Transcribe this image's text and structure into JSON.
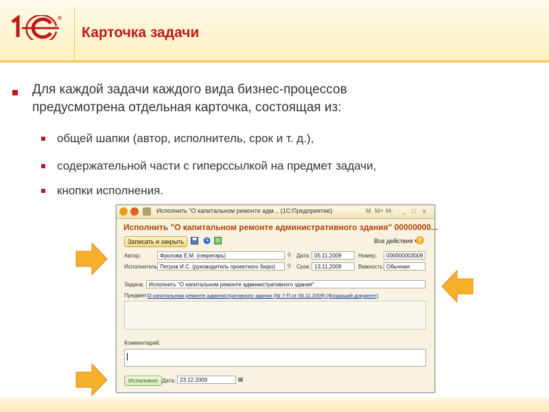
{
  "slide": {
    "title": "Карточка задачи",
    "bullet_line1": "Для каждой задачи каждого вида бизнес-процессов",
    "bullet_line2": "предусмотрена отдельная карточка, состоящая из:",
    "sub_bullets": [
      "общей шапки (автор, исполнитель, срок и т. д.),",
      "содержательной части с гиперссылкой на предмет задачи,",
      "кнопки исполнения."
    ],
    "accent_color": "#c01818",
    "arrow_color": "#f7b02a"
  },
  "window": {
    "title": "Исполнить \"О капитальном ремонте адм... (1С:Предприятие)",
    "controls": [
      "M",
      "M+",
      "M-",
      "_",
      "□",
      "x"
    ],
    "form_title": "Исполнить \"О капитальном ремонте административного здания\" 00000000...",
    "toolbar": {
      "save_close": "Записать и закрыть",
      "all_actions": "Все действия ▾",
      "help": "?"
    },
    "fields": {
      "author_label": "Автор:",
      "author_value": "Фролова Е.М. (секретарь)",
      "date_label": "Дата:",
      "date_value": "05.11.2009",
      "number_label": "Номер:",
      "number_value": "000000003009",
      "executor_label": "Исполнитель:",
      "executor_value": "Петров И.С. (руководитель проектного бюро)",
      "deadline_label": "Срок:",
      "deadline_value": "13.11.2009",
      "importance_label": "Важность:",
      "importance_value": "Обычная",
      "task_label": "Задача:",
      "task_value": "Исполнить \"О капитальном ремонте административного здания\"",
      "subject_label": "Предмет:",
      "subject_link": "О капитальном ремонте административного здания (№ 7-П от 05.11.2009) (Входящий документ)",
      "comment_label": "Комментарий:"
    },
    "footer": {
      "done_button": "Исполнено",
      "date_label": "Дата:",
      "date_value": "23.12.2009"
    }
  }
}
